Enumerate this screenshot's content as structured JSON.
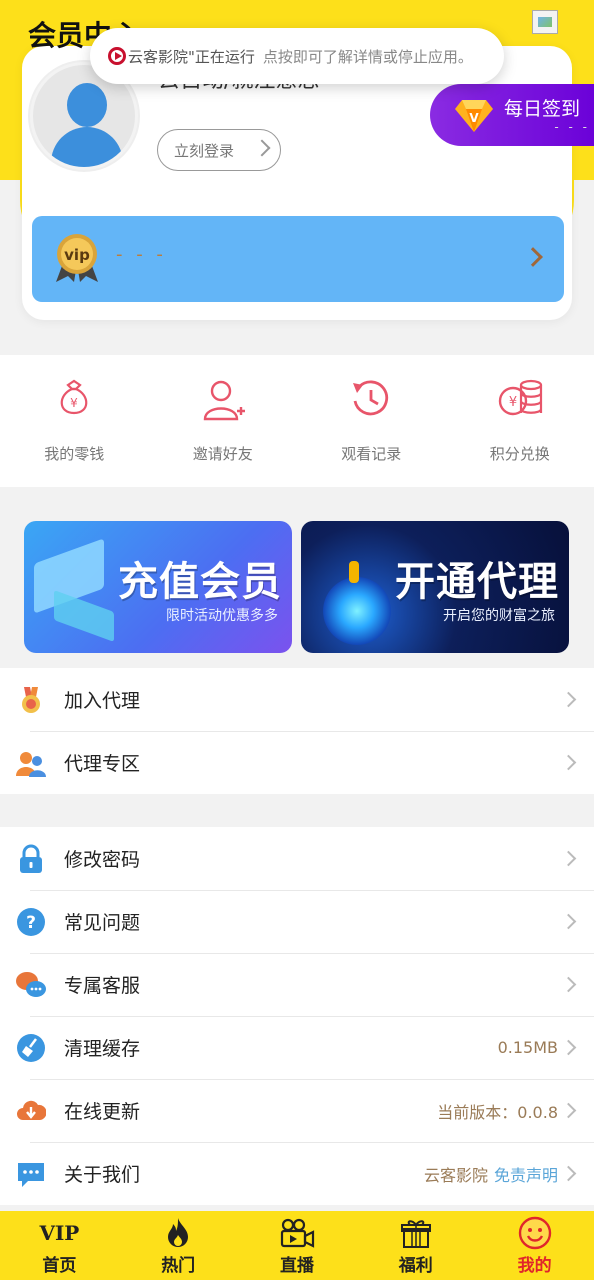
{
  "header": {
    "title": "会员中心"
  },
  "toast": {
    "app_name": "云客影院\"正在运行",
    "message": "点按即可了解详情或停止应用。"
  },
  "profile": {
    "username": "去自动/就注意思",
    "login_button": "立刻登录"
  },
  "checkin": {
    "label": "每日签到",
    "sub": "- - -"
  },
  "vip": {
    "badge": "vip",
    "status": "- - -"
  },
  "quick_actions": [
    {
      "label": "我的零钱",
      "icon": "money-bag-icon"
    },
    {
      "label": "邀请好友",
      "icon": "add-user-icon"
    },
    {
      "label": "观看记录",
      "icon": "history-clock-icon"
    },
    {
      "label": "积分兑换",
      "icon": "coins-icon"
    }
  ],
  "banners": [
    {
      "title": "充值会员",
      "subtitle": "限时活动优惠多多"
    },
    {
      "title": "开通代理",
      "subtitle": "开启您的财富之旅"
    }
  ],
  "menu_group_1": [
    {
      "label": "加入代理",
      "icon": "medal-icon"
    },
    {
      "label": "代理专区",
      "icon": "people-icon"
    }
  ],
  "menu_group_2": [
    {
      "label": "修改密码",
      "icon": "lock-icon",
      "value": ""
    },
    {
      "label": "常见问题",
      "icon": "question-icon",
      "value": ""
    },
    {
      "label": "专属客服",
      "icon": "chat-icon",
      "value": ""
    },
    {
      "label": "清理缓存",
      "icon": "broom-icon",
      "value": "0.15MB"
    },
    {
      "label": "在线更新",
      "icon": "cloud-download-icon",
      "value": "当前版本：0.0.8"
    },
    {
      "label": "关于我们",
      "icon": "message-icon",
      "value": "云客影院",
      "value2": "免责声明"
    }
  ],
  "tabbar": [
    {
      "label": "首页",
      "icon": "vip-logo-icon",
      "icon_text": "VIP"
    },
    {
      "label": "热门",
      "icon": "fire-icon"
    },
    {
      "label": "直播",
      "icon": "video-camera-icon"
    },
    {
      "label": "福利",
      "icon": "gift-icon"
    },
    {
      "label": "我的",
      "icon": "smiley-icon",
      "active": true
    }
  ],
  "colors": {
    "brand_yellow": "#fde01a",
    "vip_blue": "#63b5f7",
    "active_tab": "#e0262b",
    "checkin_purple": "#8a2be2"
  }
}
